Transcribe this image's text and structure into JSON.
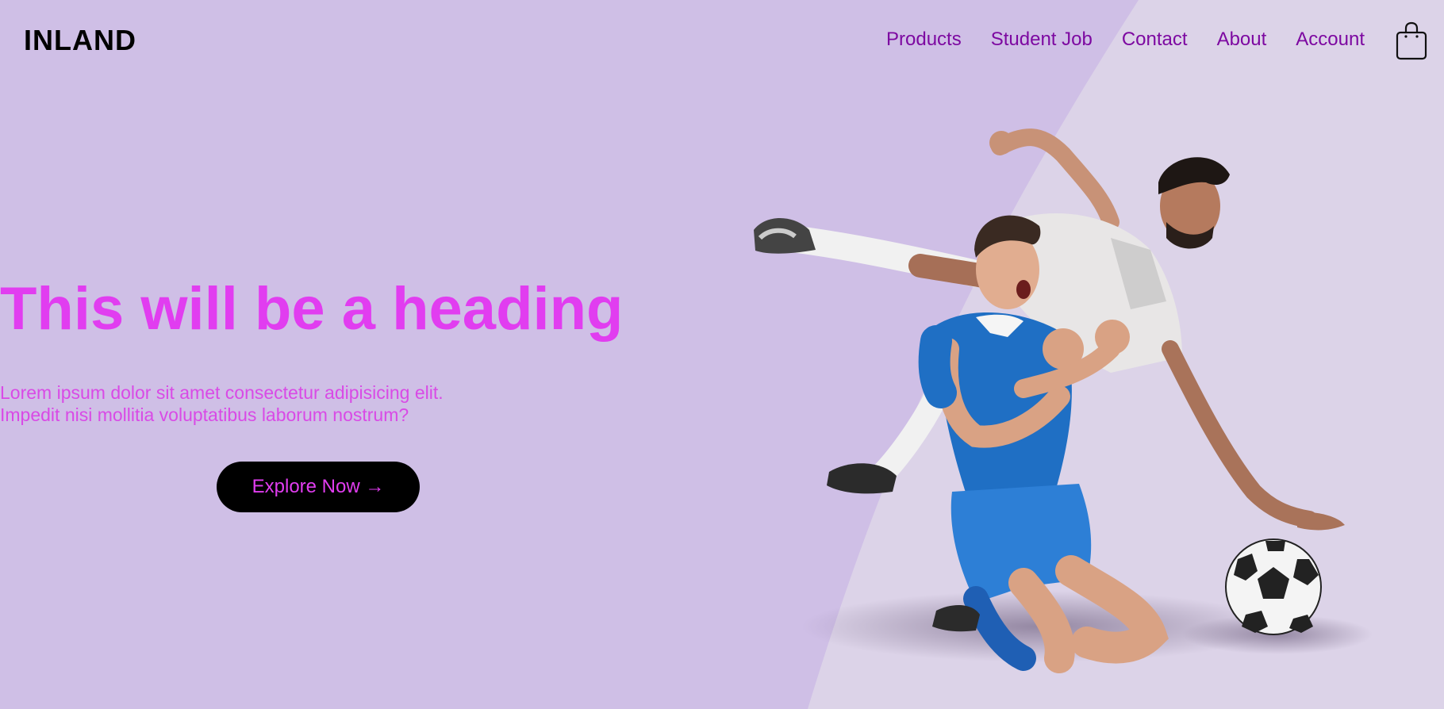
{
  "brand": {
    "logo_text": "INLAND"
  },
  "nav": {
    "items": [
      {
        "label": "Products"
      },
      {
        "label": "Student Job"
      },
      {
        "label": "Contact"
      },
      {
        "label": "About"
      },
      {
        "label": "Account"
      }
    ],
    "cart_icon": "shopping-bag-icon"
  },
  "hero": {
    "title": "This will be a heading",
    "subtitle_line1": "Lorem ipsum dolor sit amet consectetur adipisicing elit.",
    "subtitle_line2": "Impedit nisi mollitia voluptatibus laborum nostrum?",
    "cta_label": "Explore Now →",
    "image_subject": "two-soccer-players-with-ball"
  },
  "colors": {
    "background": "#cfbfe6",
    "background_light": "#dcd3e8",
    "accent": "#e13df0",
    "nav_link": "#7d09a1",
    "button_bg": "#000000"
  }
}
